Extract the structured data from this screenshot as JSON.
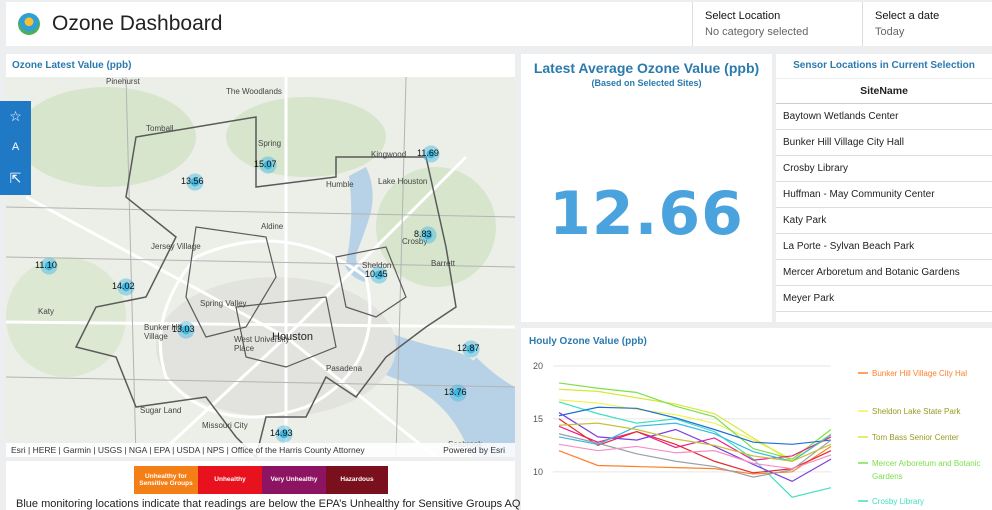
{
  "app": {
    "title": "Ozone Dashboard"
  },
  "selectors": {
    "location": {
      "label": "Select Location",
      "value": "No category selected"
    },
    "date": {
      "label": "Select a date",
      "value": "Today"
    }
  },
  "map": {
    "title": "Ozone Latest Value (ppb)",
    "place_labels": [
      "Pinehurst",
      "The Woodlands",
      "Tomball",
      "Spring",
      "Kingwood",
      "Humble",
      "Lake Houston",
      "Jersey Village",
      "Aldine",
      "Crosby",
      "Barrett",
      "Sheldon",
      "Katy",
      "Spring Valley",
      "Bunker Hill Village",
      "West University Place",
      "Houston",
      "Pasadena",
      "Sugar Land",
      "Missouri City",
      "Seabrook"
    ],
    "markers": [
      "15.07",
      "11.69",
      "13.56",
      "8.83",
      "11.10",
      "10.45",
      "14.02",
      "13.03",
      "12.87",
      "13.76",
      "14.93"
    ],
    "attribution": "Esri | HERE | Garmin | USGS | NGA | EPA | USDA | NPS | Office of the Harris County Attorney",
    "powered_by": "Powered by Esri",
    "sidebar_icons": [
      "star-icon",
      "translate-icon",
      "share-icon"
    ]
  },
  "aqi_legend": {
    "items": [
      {
        "label": "Unhealthy for Sensitive Groups",
        "color": "#f57f17"
      },
      {
        "label": "Unhealthy",
        "color": "#e8121e"
      },
      {
        "label": "Very Unhealthy",
        "color": "#8c1463"
      },
      {
        "label": "Hazardous",
        "color": "#7a0f1e"
      }
    ],
    "text": "Blue monitoring locations indicate that readings are below the EPA’s Unhealthy for Sensitive Groups AQI level"
  },
  "kpi": {
    "title": "Latest Average Ozone Value (ppb)",
    "subtitle": "(Based on Selected Sites)",
    "value": "12.66"
  },
  "sites_table": {
    "title": "Sensor Locations in Current Selection",
    "header": "SiteName",
    "rows": [
      "Baytown Wetlands Center",
      "Bunker Hill Village City Hall",
      "Crosby Library",
      "Huffman - May Community Center",
      "Katy Park",
      "La Porte - Sylvan Beach Park",
      "Mercer Arboretum and Botanic Gardens",
      "Meyer Park"
    ]
  },
  "chart_data": {
    "type": "line",
    "title": "Houly Ozone Value (ppb)",
    "ylim": [
      8,
      20
    ],
    "yticks": [
      10,
      15,
      20
    ],
    "x": [
      1,
      2,
      3,
      4,
      5,
      6,
      7,
      8
    ],
    "series": [
      {
        "name": "Bunker Hill Village City Hall",
        "color": "#ff7f2a",
        "values": [
          12.0,
          10.6,
          10.5,
          10.4,
          10.3,
          9.8,
          10.0,
          12.4
        ]
      },
      {
        "name": "Sheldon Lake State Park",
        "color": "#f2f24b",
        "values": [
          16.8,
          16.5,
          15.9,
          15.4,
          14.6,
          13.0,
          11.2,
          13.3
        ]
      },
      {
        "name": "Tom Bass Senior Center",
        "color": "#d8e83a",
        "values": [
          17.8,
          17.6,
          17.0,
          16.4,
          15.5,
          13.2,
          11.0,
          13.6
        ]
      },
      {
        "name": "Mercer Arboretum and Botanic Gardens",
        "color": "#7be04a",
        "values": [
          18.4,
          17.9,
          17.5,
          16.2,
          15.2,
          12.2,
          11.2,
          14.0
        ]
      },
      {
        "name": "Crosby Library",
        "color": "#3fe0c0",
        "values": [
          16.6,
          15.5,
          14.6,
          15.0,
          13.8,
          11.2,
          7.6,
          8.5
        ]
      },
      {
        "name": "",
        "color": "#1e6fd9",
        "values": [
          15.3,
          16.1,
          16.0,
          15.1,
          14.0,
          12.8,
          12.6,
          13.0
        ]
      },
      {
        "name": "",
        "color": "#ee1f8a",
        "values": [
          14.3,
          12.8,
          13.8,
          12.3,
          13.2,
          11.1,
          11.5,
          13.3
        ]
      },
      {
        "name": "",
        "color": "#e52a2a",
        "values": [
          15.0,
          12.5,
          13.8,
          12.6,
          11.0,
          9.9,
          10.3,
          12.0
        ]
      },
      {
        "name": "",
        "color": "#7b3fe0",
        "values": [
          15.6,
          13.3,
          13.0,
          14.0,
          12.4,
          10.7,
          9.1,
          11.2
        ]
      },
      {
        "name": "",
        "color": "#39b8e8",
        "values": [
          13.3,
          12.6,
          14.3,
          14.6,
          13.6,
          11.9,
          11.0,
          13.5
        ]
      },
      {
        "name": "",
        "color": "#9aa0a8",
        "values": [
          13.6,
          12.7,
          11.7,
          11.0,
          10.5,
          9.5,
          10.2,
          13.0
        ]
      },
      {
        "name": "",
        "color": "#c7c03b",
        "values": [
          14.4,
          14.6,
          14.0,
          13.1,
          12.5,
          11.5,
          11.0,
          12.6
        ]
      },
      {
        "name": "",
        "color": "#f58fc6",
        "values": [
          12.6,
          12.0,
          12.4,
          11.8,
          12.0,
          10.8,
          10.3,
          11.6
        ]
      }
    ]
  }
}
